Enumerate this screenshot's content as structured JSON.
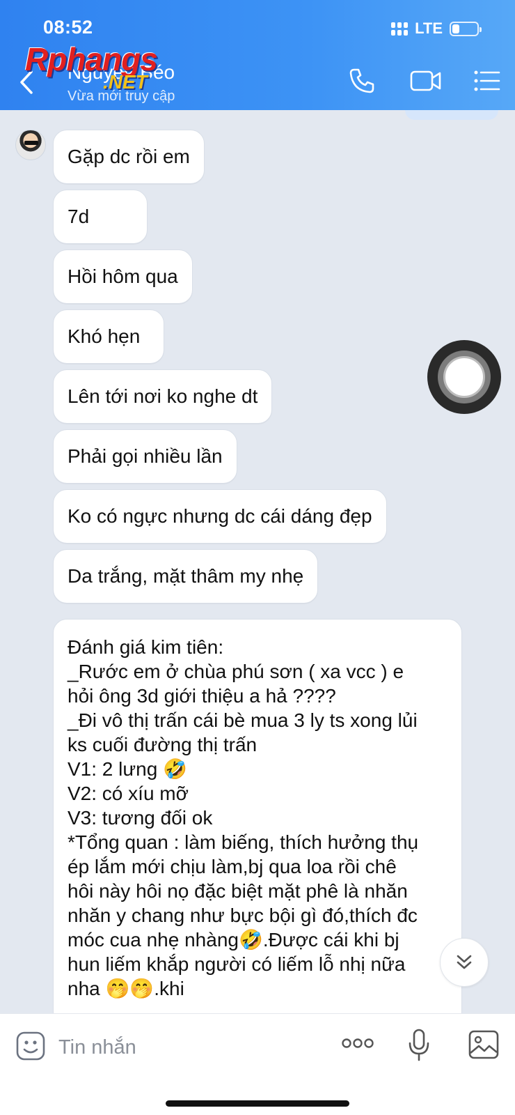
{
  "status_bar": {
    "time": "08:52",
    "network": "LTE",
    "battery_level": 0.3
  },
  "header": {
    "contact_name": "Nguyễn Béo",
    "contact_status": "Vừa mới truy cập",
    "watermark": "Rphangs",
    "watermark_suffix": ".NET",
    "icons": [
      "back-icon",
      "phone-icon",
      "video-call-icon",
      "menu-icon"
    ]
  },
  "messages": [
    "Gặp dc rồi em",
    "7d",
    "Hồi hôm qua",
    "Khó hẹn",
    "Lên tới nơi ko nghe dt",
    "Phải gọi nhiều lần",
    "Ko có ngực nhưng dc cái dáng đẹp",
    "Da trắng, mặt thâm my nhẹ"
  ],
  "long_message": [
    "Đánh giá kim tiên:",
    "_Rước em ở chùa phú sơn ( xa vcc ) e",
    "hỏi ông 3d giới thiệu a hả ????",
    "_Đi vô thị trấn cái bè mua 3 ly ts xong lủi",
    "ks cuối đường thị trấn",
    "V1: 2 lưng 🤣",
    "V2: có xíu mỡ",
    "V3: tương đối ok",
    "*Tổng quan : làm biếng, thích hưởng thụ",
    "ép lắm mới chịu làm,bj qua loa rồi chê",
    "hôi này hôi nọ đặc biệt mặt phê là nhăn",
    "nhăn y chang như bực bội gì đó,thích đc",
    "móc cua nhẹ nhàng🤣.Được cái khi bj",
    "hun liếm khắp người có liếm lỗ nhị nữa",
    "nha 🤭🤭.khi"
  ],
  "composer": {
    "placeholder": "Tin nhắn",
    "icons": [
      "emoji-icon",
      "more-icon",
      "microphone-icon",
      "image-icon"
    ]
  },
  "colors": {
    "header_start": "#2f82f0",
    "header_end": "#57a8f7",
    "chat_bg": "#e3e8f0",
    "bubble_bg": "#ffffff"
  }
}
